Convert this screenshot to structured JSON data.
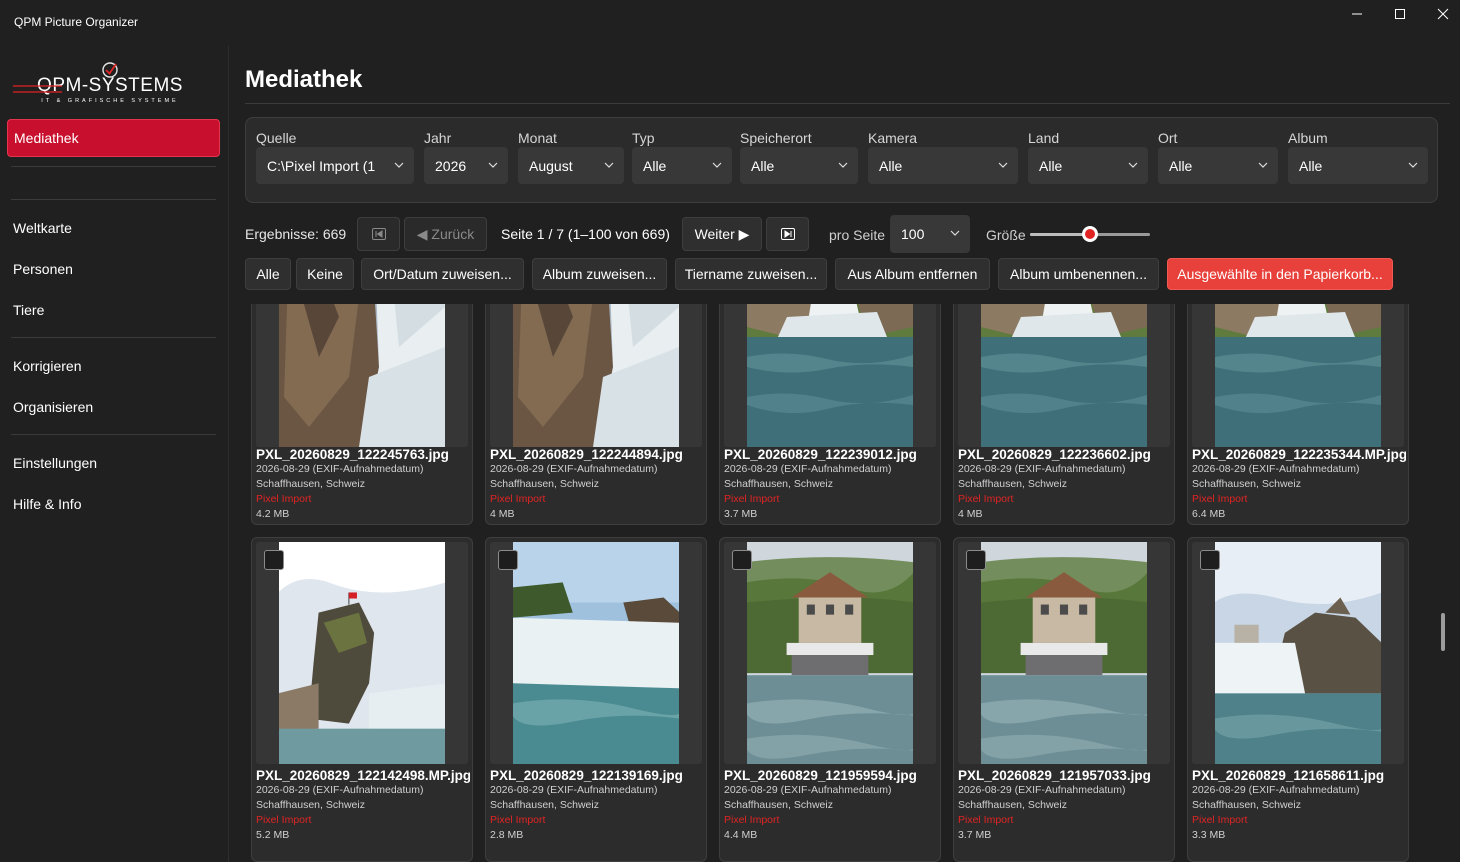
{
  "app": {
    "title": "QPM Picture Organizer"
  },
  "logo": {
    "text": "QPM-SYSTEMS",
    "tagline": "IT & GRAFISCHE SYSTEME"
  },
  "sidebar": {
    "items": [
      {
        "label": "Mediathek",
        "active": true
      },
      {
        "label": "Weltkarte"
      },
      {
        "label": "Personen"
      },
      {
        "label": "Tiere"
      },
      {
        "label": "Korrigieren"
      },
      {
        "label": "Organisieren"
      },
      {
        "label": "Einstellungen"
      },
      {
        "label": "Hilfe & Info"
      }
    ]
  },
  "page": {
    "title": "Mediathek"
  },
  "filters": [
    {
      "label": "Quelle",
      "value": "C:\\Pixel Import  (1"
    },
    {
      "label": "Jahr",
      "value": "2026"
    },
    {
      "label": "Monat",
      "value": "August"
    },
    {
      "label": "Typ",
      "value": "Alle"
    },
    {
      "label": "Speicherort",
      "value": "Alle"
    },
    {
      "label": "Kamera",
      "value": "Alle"
    },
    {
      "label": "Land",
      "value": "Alle"
    },
    {
      "label": "Ort",
      "value": "Alle"
    },
    {
      "label": "Album",
      "value": "Alle"
    }
  ],
  "pager": {
    "results": "Ergebnisse: 669",
    "back": "◀ Zurück",
    "page_info": "Seite 1 / 7 (1–100 von 669)",
    "next": "Weiter ▶",
    "per_page_label": "pro Seite",
    "per_page_value": "100",
    "size_label": "Größe",
    "size_level": 0.5
  },
  "actions": {
    "all": "Alle",
    "none": "Keine",
    "assign_place_date": "Ort/Datum zuweisen...",
    "assign_album": "Album zuweisen...",
    "assign_animal": "Tiername zuweisen...",
    "remove_album": "Aus Album entfernen",
    "rename_album": "Album umbenennen...",
    "trash": "Ausgewählte in den Papierkorb..."
  },
  "colors": {
    "accent": "#c8102e",
    "danger": "#e8403a",
    "source_text": "#e02424"
  },
  "photos": [
    {
      "name": "PXL_20260829_122245763.jpg",
      "date": "2026-08-29 (EXIF-Aufnahmedatum)",
      "location": "Schaffhausen, Schweiz",
      "source": "Pixel Import",
      "size": "4.2 MB",
      "scene": "falls-rock"
    },
    {
      "name": "PXL_20260829_122244894.jpg",
      "date": "2026-08-29 (EXIF-Aufnahmedatum)",
      "location": "Schaffhausen, Schweiz",
      "source": "Pixel Import",
      "size": "4 MB",
      "scene": "falls-rock"
    },
    {
      "name": "PXL_20260829_122239012.jpg",
      "date": "2026-08-29 (EXIF-Aufnahmedatum)",
      "location": "Schaffhausen, Schweiz",
      "source": "Pixel Import",
      "size": "3.7 MB",
      "scene": "falls-wide"
    },
    {
      "name": "PXL_20260829_122236602.jpg",
      "date": "2026-08-29 (EXIF-Aufnahmedatum)",
      "location": "Schaffhausen, Schweiz",
      "source": "Pixel Import",
      "size": "4 MB",
      "scene": "falls-wide"
    },
    {
      "name": "PXL_20260829_122235344.MP.jpg",
      "date": "2026-08-29 (EXIF-Aufnahmedatum)",
      "location": "Schaffhausen, Schweiz",
      "source": "Pixel Import",
      "size": "6.4 MB",
      "scene": "falls-wide"
    },
    {
      "name": "PXL_20260829_122142498.MP.jpg",
      "date": "2026-08-29 (EXIF-Aufnahmedatum)",
      "location": "Schaffhausen, Schweiz",
      "source": "Pixel Import",
      "size": "5.2 MB",
      "scene": "rock-flag"
    },
    {
      "name": "PXL_20260829_122139169.jpg",
      "date": "2026-08-29 (EXIF-Aufnahmedatum)",
      "location": "Schaffhausen, Schweiz",
      "source": "Pixel Import",
      "size": "2.8 MB",
      "scene": "rapids"
    },
    {
      "name": "PXL_20260829_121959594.jpg",
      "date": "2026-08-29 (EXIF-Aufnahmedatum)",
      "location": "Schaffhausen, Schweiz",
      "source": "Pixel Import",
      "size": "4.4 MB",
      "scene": "house"
    },
    {
      "name": "PXL_20260829_121957033.jpg",
      "date": "2026-08-29 (EXIF-Aufnahmedatum)",
      "location": "Schaffhausen, Schweiz",
      "source": "Pixel Import",
      "size": "3.7 MB",
      "scene": "house"
    },
    {
      "name": "PXL_20260829_121658611.jpg",
      "date": "2026-08-29 (EXIF-Aufnahmedatum)",
      "location": "Schaffhausen, Schweiz",
      "source": "Pixel Import",
      "size": "3.3 MB",
      "scene": "rock-castle"
    }
  ]
}
